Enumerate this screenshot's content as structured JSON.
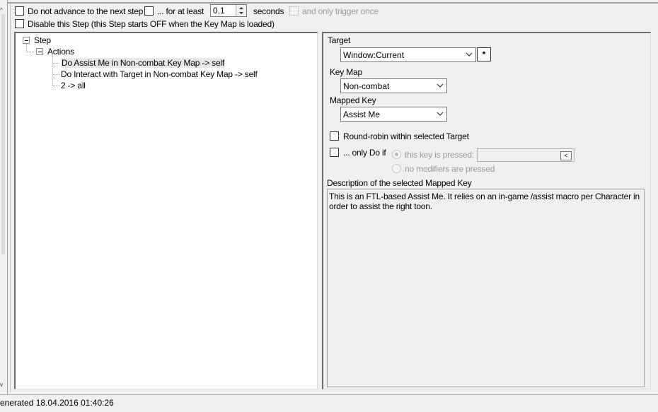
{
  "top_options": {
    "no_advance_label": "Do not advance to the next step",
    "for_at_least_label": "... for at least",
    "duration_value": "0,1",
    "seconds_label": "seconds",
    "trigger_once_label": "and only trigger once",
    "disable_step_label": "Disable this Step (this Step starts OFF when the Key Map is loaded)"
  },
  "tree": {
    "root_label": "Step",
    "actions_label": "Actions",
    "items": [
      "Do Assist Me in Non-combat Key Map -> self",
      "Do Interact with Target in Non-combat Key Map -> self",
      "2 -> all"
    ]
  },
  "details": {
    "target_label": "Target",
    "target_value": "Window:Current",
    "target_extra_button": "*",
    "key_map_label": "Key Map",
    "key_map_value": "Non-combat",
    "mapped_key_label": "Mapped Key",
    "mapped_key_value": "Assist Me",
    "round_robin_label": "Round-robin within selected Target",
    "only_do_if_label": "... only Do if",
    "this_key_pressed_label": "this key is pressed:",
    "no_modifiers_label": "no modifiers are pressed",
    "key_picker_button": "<",
    "description_label": "Description of the selected Mapped Key",
    "description_text": "This is an FTL-based Assist Me. It relies on an in-game /assist macro per Character in order to assist the right toon."
  },
  "status_bar": {
    "text": "enerated 18.04.2016 01:40:26"
  }
}
